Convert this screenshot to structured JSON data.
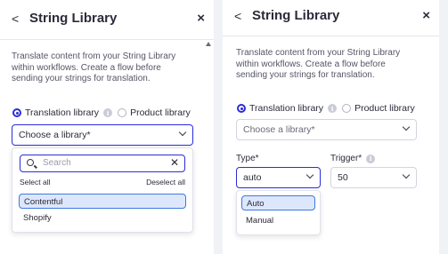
{
  "left": {
    "title": "String Library",
    "description": "Translate content from your String Library within workflows. Create a flow before sending your strings for translation.",
    "radio_translation": "Translation library",
    "radio_product": "Product library",
    "select_placeholder": "Choose a library*",
    "search_placeholder": "Search",
    "select_all": "Select all",
    "deselect_all": "Deselect all",
    "options": [
      "Contentful",
      "Shopify"
    ]
  },
  "right": {
    "title": "String Library",
    "description": "Translate content from your String Library within workflows. Create a flow before sending your strings for translation.",
    "radio_translation": "Translation library",
    "radio_product": "Product library",
    "select_placeholder": "Choose a library*",
    "type_label": "Type*",
    "type_value": "auto",
    "type_options": [
      "Auto",
      "Manual"
    ],
    "trigger_label": "Trigger*",
    "trigger_value": "50"
  },
  "icons": {
    "back": "<",
    "close": "×",
    "info": "i"
  },
  "colors": {
    "accent": "#2a2dd8",
    "highlight_bg": "#dde7fb",
    "highlight_border": "#3e78e0"
  }
}
